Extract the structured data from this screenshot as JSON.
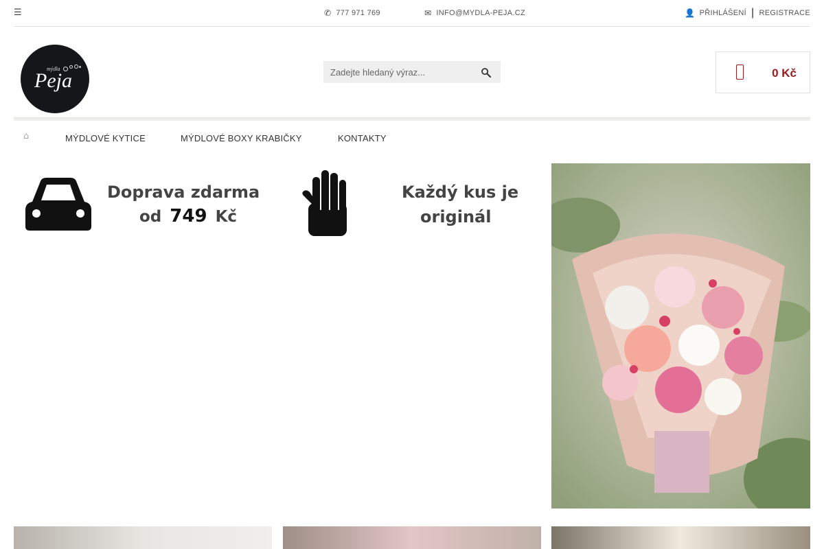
{
  "topbar": {
    "phone": "777 971 769",
    "email": "INFO@MYDLA-PEJA.CZ",
    "login": "PŘIHLÁŠENÍ",
    "separator": "|",
    "register": "REGISTRACE"
  },
  "logo": {
    "small": "mýdla",
    "big": "Peja"
  },
  "search": {
    "placeholder": "Zadejte hledaný výraz..."
  },
  "cart": {
    "total": "0 Kč"
  },
  "nav": {
    "items": [
      "MÝDLOVÉ KYTICE",
      "MÝDLOVÉ BOXY KRABIČKY",
      "KONTAKTY"
    ]
  },
  "banners": {
    "shipping": {
      "line1": "Doprava zdarma",
      "line2_prefix": "od",
      "line2_value": "749",
      "line2_suffix": "Kč"
    },
    "original": {
      "line1": "Každý kus je",
      "line2": "originál"
    }
  },
  "icons": {
    "menu": "hamburger-icon",
    "phone": "phone-icon",
    "email": "envelope-icon",
    "account": "user-icon",
    "search": "magnifier-icon",
    "cart": "shopping-bag-icon",
    "home": "home-icon"
  },
  "colors": {
    "accent": "#9b1b1b",
    "search_bg": "#efefef"
  }
}
